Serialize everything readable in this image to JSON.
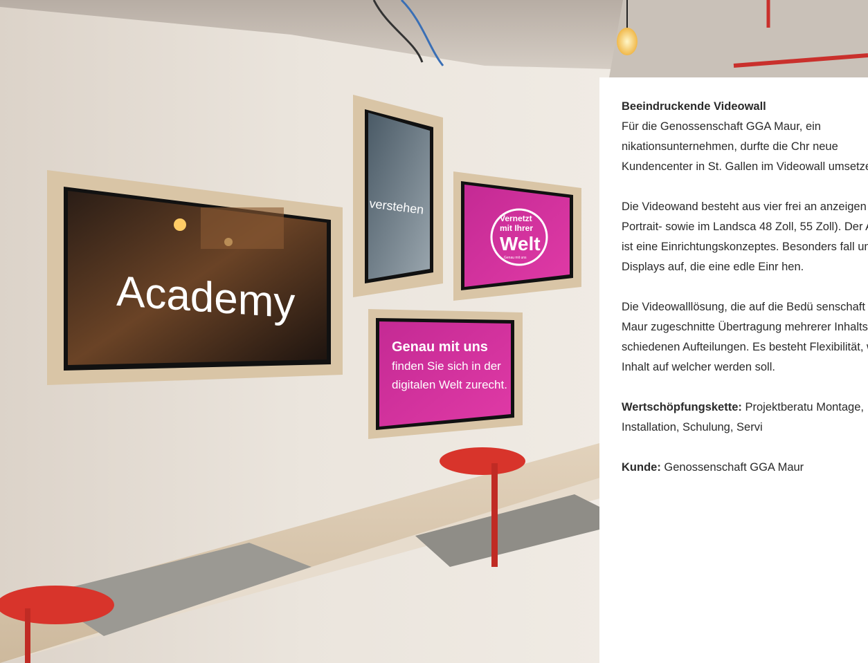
{
  "photo": {
    "screens": {
      "large": {
        "text": "Academy"
      },
      "portrait": {
        "text": "verstehen"
      },
      "small_right": {
        "line1": "Vernetzt",
        "line2": "mit Ihrer",
        "line3": "Welt",
        "line4": "Genau mit uns"
      },
      "bottom": {
        "line1": "Genau mit uns",
        "line2": "finden Sie sich in der",
        "line3": "digitalen Welt zurecht."
      }
    }
  },
  "article": {
    "heading": "Beeindruckende Videowall",
    "para1": "Für die Genossenschaft GGA Maur, ein nikationsunternehmen, durfte die Chr neue Kundencenter in St. Gallen im Videowall umsetzen.",
    "para2": "Die Videowand besteht aus vier frei an anzeigen im Portrait- sowie im Landsca 48 Zoll, 55 Zoll). Der Auftritt ist eine Einrichtungskonzeptes. Besonders fall um die Displays auf, die eine edle Einr hen.",
    "para3": "Die Videowalllösung, die auf die Bedü senschaft GGA Maur zugeschnitte Übertragung mehrerer Inhaltstypen, b schiedenen Aufteilungen. Es besteht Flexibilität, welcher Inhalt auf welcher werden soll.",
    "chain_label": "Wertschöpfungskette:",
    "chain_value": " Projektberatu Montage, Installation, Schulung, Servi",
    "client_label": "Kunde:",
    "client_value": " Genossenschaft GGA Maur"
  },
  "colors": {
    "magenta": "#d62f9e",
    "wood": "#d9c5a6",
    "wall": "#f0ebe4",
    "red": "#d8342b"
  }
}
